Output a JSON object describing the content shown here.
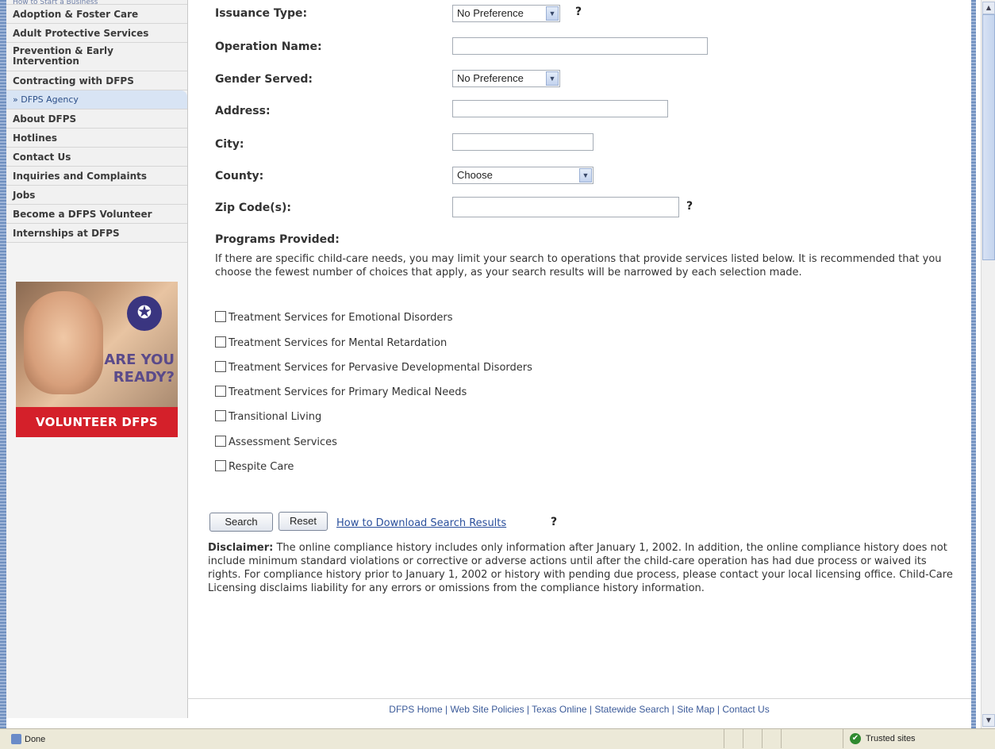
{
  "sidebar": {
    "top_item": "How to Start a Business",
    "items": [
      {
        "label": "Adoption & Foster Care"
      },
      {
        "label": "Adult Protective Services"
      },
      {
        "label": "Prevention & Early Intervention"
      },
      {
        "label": "Contracting with DFPS"
      },
      {
        "label": "» DFPS Agency"
      },
      {
        "label": "About DFPS"
      },
      {
        "label": "Hotlines"
      },
      {
        "label": "Contact Us"
      },
      {
        "label": "Inquiries and Complaints"
      },
      {
        "label": "Jobs"
      },
      {
        "label": "Become a DFPS Volunteer"
      },
      {
        "label": "Internships at DFPS"
      }
    ],
    "promo": {
      "tagline": "ARE YOU READY?",
      "banner": "VOLUNTEER DFPS"
    }
  },
  "form": {
    "issuance_type": {
      "label": "Issuance Type:",
      "value": "No Preference",
      "help": "?"
    },
    "operation_name": {
      "label": "Operation Name:",
      "value": ""
    },
    "gender_served": {
      "label": "Gender Served:",
      "value": "No Preference"
    },
    "address": {
      "label": "Address:",
      "value": ""
    },
    "city": {
      "label": "City:",
      "value": ""
    },
    "county": {
      "label": "County:",
      "value": "Choose"
    },
    "zip": {
      "label": "Zip Code(s):",
      "value": "",
      "help": "?"
    }
  },
  "programs": {
    "title": "Programs Provided:",
    "intro": "If there are specific child-care needs, you may limit your search to operations that provide services listed below. It is recommended that you choose the fewest number of choices that apply, as your search results will be narrowed by each selection made.",
    "options": [
      {
        "label": "Treatment Services for Emotional Disorders"
      },
      {
        "label": "Treatment Services for Mental Retardation"
      },
      {
        "label": "Treatment Services for Pervasive Developmental Disorders"
      },
      {
        "label": "Treatment Services for Primary Medical Needs"
      },
      {
        "label": "Transitional Living"
      },
      {
        "label": "Assessment Services"
      },
      {
        "label": "Respite Care"
      }
    ]
  },
  "actions": {
    "search": "Search",
    "reset": "Reset",
    "download_link": "How to Download Search Results ",
    "download_help": "?"
  },
  "disclaimer": {
    "label": "Disclaimer:",
    "text": " The online compliance history includes only information after January 1, 2002. In addition, the online compliance history does not include minimum standard violations or corrective or adverse actions until after the child-care operation has had due process or waived its rights. For compliance history prior to January 1, 2002 or history with pending due process, please contact your local licensing office. Child-Care Licensing disclaims liability for any errors or omissions from the compliance history information."
  },
  "footer": {
    "links": [
      "DFPS Home",
      "Web Site Policies",
      "Texas Online",
      "Statewide Search",
      "Site Map",
      "Contact Us"
    ]
  },
  "statusbar": {
    "status": "Done",
    "zone": "Trusted sites"
  }
}
